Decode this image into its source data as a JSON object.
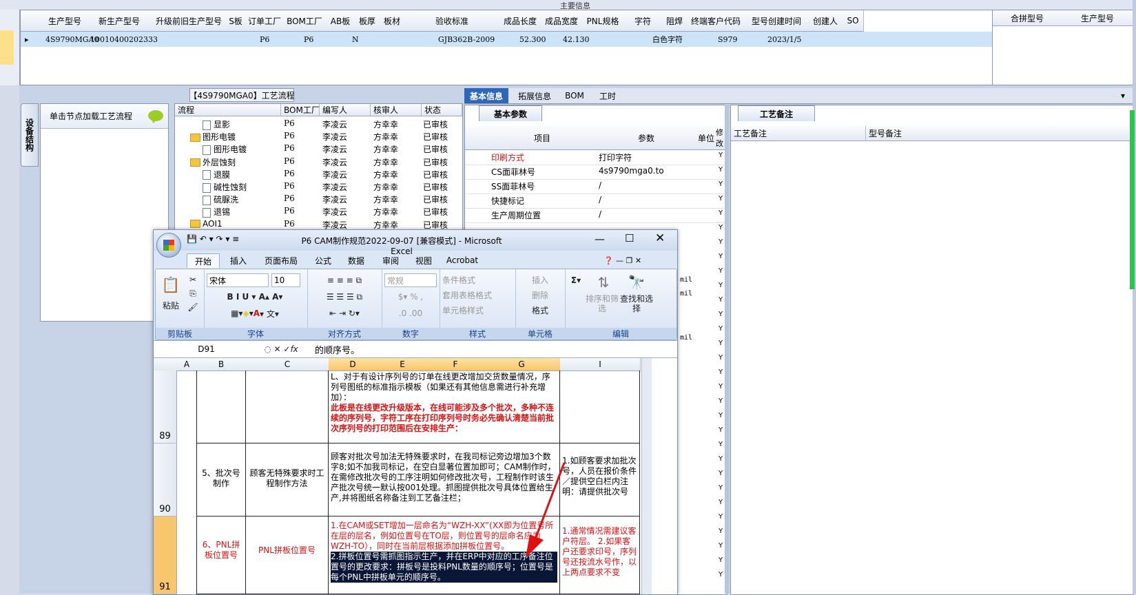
{
  "top_title": "主要信息",
  "grid_headers": [
    "生产型号",
    "新生产型号",
    "升级前旧生产型号",
    "S板",
    "订单工厂",
    "BOM工厂",
    "AB板",
    "板厚",
    "板材",
    "验收标准",
    "成品长度",
    "成品宽度",
    "PNL规格",
    "字符",
    "阻焊",
    "终端客户代码",
    "型号创建时间",
    "创建人",
    "SO"
  ],
  "grid_row": {
    "prod": "4S9790MGA0",
    "newprod": "10010400202333",
    "order_factory": "P6",
    "bom_factory": "P6",
    "ab": "N",
    "standard": "GJB362B-2009",
    "length": "52.300",
    "width": "42.130",
    "char": "白色字符",
    "customer": "S979",
    "created": "2023/1/5"
  },
  "right_headers": [
    "合拼型号",
    "生产型号"
  ],
  "side_tab": "设备结构",
  "left_panel_text": "单击节点加载工艺流程",
  "process_title": "【4S9790MGA0】工艺流程",
  "tree_headers": [
    "流程",
    "BOM工厂",
    "编写人",
    "核审人",
    "状态"
  ],
  "tree_rows": [
    {
      "name": "显影",
      "folder": false,
      "indent": 2,
      "bom": "P6",
      "writer": "李凌云",
      "reviewer": "方幸幸",
      "status": "已审核"
    },
    {
      "name": "图形电镀",
      "folder": true,
      "indent": 1,
      "bom": "P6",
      "writer": "李凌云",
      "reviewer": "方幸幸",
      "status": "已审核"
    },
    {
      "name": "图形电镀",
      "folder": false,
      "indent": 2,
      "bom": "P6",
      "writer": "李凌云",
      "reviewer": "方幸幸",
      "status": "已审核"
    },
    {
      "name": "外层蚀刻",
      "folder": true,
      "indent": 1,
      "bom": "P6",
      "writer": "李凌云",
      "reviewer": "方幸幸",
      "status": "已审核"
    },
    {
      "name": "退膜",
      "folder": false,
      "indent": 2,
      "bom": "P6",
      "writer": "李凌云",
      "reviewer": "方幸幸",
      "status": "已审核"
    },
    {
      "name": "碱性蚀刻",
      "folder": false,
      "indent": 2,
      "bom": "P6",
      "writer": "李凌云",
      "reviewer": "方幸幸",
      "status": "已审核"
    },
    {
      "name": "硫脲洗",
      "folder": false,
      "indent": 2,
      "bom": "P6",
      "writer": "李凌云",
      "reviewer": "方幸幸",
      "status": "已审核"
    },
    {
      "name": "退锡",
      "folder": false,
      "indent": 2,
      "bom": "P6",
      "writer": "李凌云",
      "reviewer": "方幸幸",
      "status": "已审核"
    },
    {
      "name": "AOI1",
      "folder": true,
      "indent": 1,
      "bom": "P6",
      "writer": "李凌云",
      "reviewer": "方幸幸",
      "status": "已审核"
    }
  ],
  "right_tabs": [
    "基本信息",
    "拓展信息",
    "BOM",
    "工时"
  ],
  "basic_subtab": "基本参数",
  "basic_headers": [
    "项目",
    "参数",
    "单位",
    "修改"
  ],
  "basic_rows": [
    {
      "item": "印刷方式",
      "param": "打印字符",
      "flag": "Y",
      "red": true
    },
    {
      "item": "CS面菲林号",
      "param": "4s9790mga0.to",
      "flag": "Y",
      "red": false
    },
    {
      "item": "SS面菲林号",
      "param": "/",
      "flag": "Y",
      "red": false
    },
    {
      "item": "快捷标记",
      "param": "/",
      "flag": "Y",
      "red": false
    },
    {
      "item": "生产周期位置",
      "param": "/",
      "flag": "Y",
      "red": false
    }
  ],
  "basic_extra_flags": [
    "Y",
    "Y",
    "Y",
    "Y",
    "Y",
    "Y",
    "Y",
    "Y",
    "Y",
    "Y",
    "Y",
    "Y",
    "Y",
    "Y",
    "Y",
    "Y",
    "Y",
    "Y",
    "Y",
    "Y",
    "Y",
    "Y",
    "Y",
    "Y",
    "Y"
  ],
  "mil_units": [
    "mil",
    "mil",
    "mil"
  ],
  "remark_tab": "工艺备注",
  "remark_headers": [
    "工艺备注",
    "型号备注"
  ],
  "excel": {
    "title": "P6 CAM制作规范2022-09-07  [兼容模式] - Microsoft Excel",
    "tabs": [
      "开始",
      "插入",
      "页面布局",
      "公式",
      "数据",
      "审阅",
      "视图",
      "Acrobat"
    ],
    "groups": [
      "剪贴板",
      "字体",
      "对齐方式",
      "数字",
      "样式",
      "单元格",
      "编辑"
    ],
    "paste": "粘贴",
    "font_name": "宋体",
    "font_size": "10",
    "number_format": "常规",
    "styles": [
      "条件格式",
      "套用表格格式",
      "单元格样式"
    ],
    "cells_btns": [
      "插入",
      "删除",
      "格式"
    ],
    "edit_btns": [
      "排序和筛选",
      "查找和选择"
    ],
    "name_box": "D91",
    "formula": "的顺序号。",
    "columns": [
      "A",
      "B",
      "C",
      "D",
      "E",
      "F",
      "G",
      "I"
    ],
    "rows": [
      "89",
      "90",
      "91"
    ],
    "r89_normal": "L、对于有设计序列号的订单在线更改增加交货数量情况，序列号图纸的标准指示模板（如果还有其他信息需进行补充增加）：",
    "r89_red": "此板是在线更改升级版本，在线可能涉及多个批次，多种不连续的序列号，字符工序在打印序列号时务必先确认清楚当前批次序列号的打印范围后在安排生产：",
    "r90_b": "5、批次号制作",
    "r90_c": "顾客无特殊要求时工程制作方法",
    "r90_d": "顾客对批次号加法无特殊要求时，在我司标记旁边增加3个数字8;如不加我司标记，在空白显著位置加即可；CAM制作时，在需修改批次号的工序注明如何修改批次号，工程制作时该生产批次号统一默认按001处理。抓图提供批次号具体位置给生产,并将图纸名称备注到工艺备注栏；",
    "r90_i": "1.如顾客要求加批次号，人员在报价条件／提供空白栏内注明：请提供批次号",
    "r91_b": "6、PNL拼板位置号",
    "r91_c": "PNL拼板位置号",
    "r91_d_red": "1.在CAM或SET增加一层命名为“WZH-XX”(XX即为位置号所在层的层名，例如位置号在TO层，则位置号的层命名应为WZH-TO），同时在当前层根据添加拼板位置号。",
    "r91_d_hl": "2.拼板位置号需抓图指示生产，并在ERP中对应的工序备注位置号的更改要求：拼板号是投料PNL数量的顺序号；位置号是每个PNL中拼板单元的顺序号。",
    "r91_i": "1.通常情况需建议客户符层。 2.如果客户还要求印号，序列号还按流水号作，以上两点要求不变"
  },
  "colors": {
    "accent": "#cde3f8",
    "arrow": "#e01010",
    "red_text": "#d11111",
    "highlight": "#0a1636"
  }
}
